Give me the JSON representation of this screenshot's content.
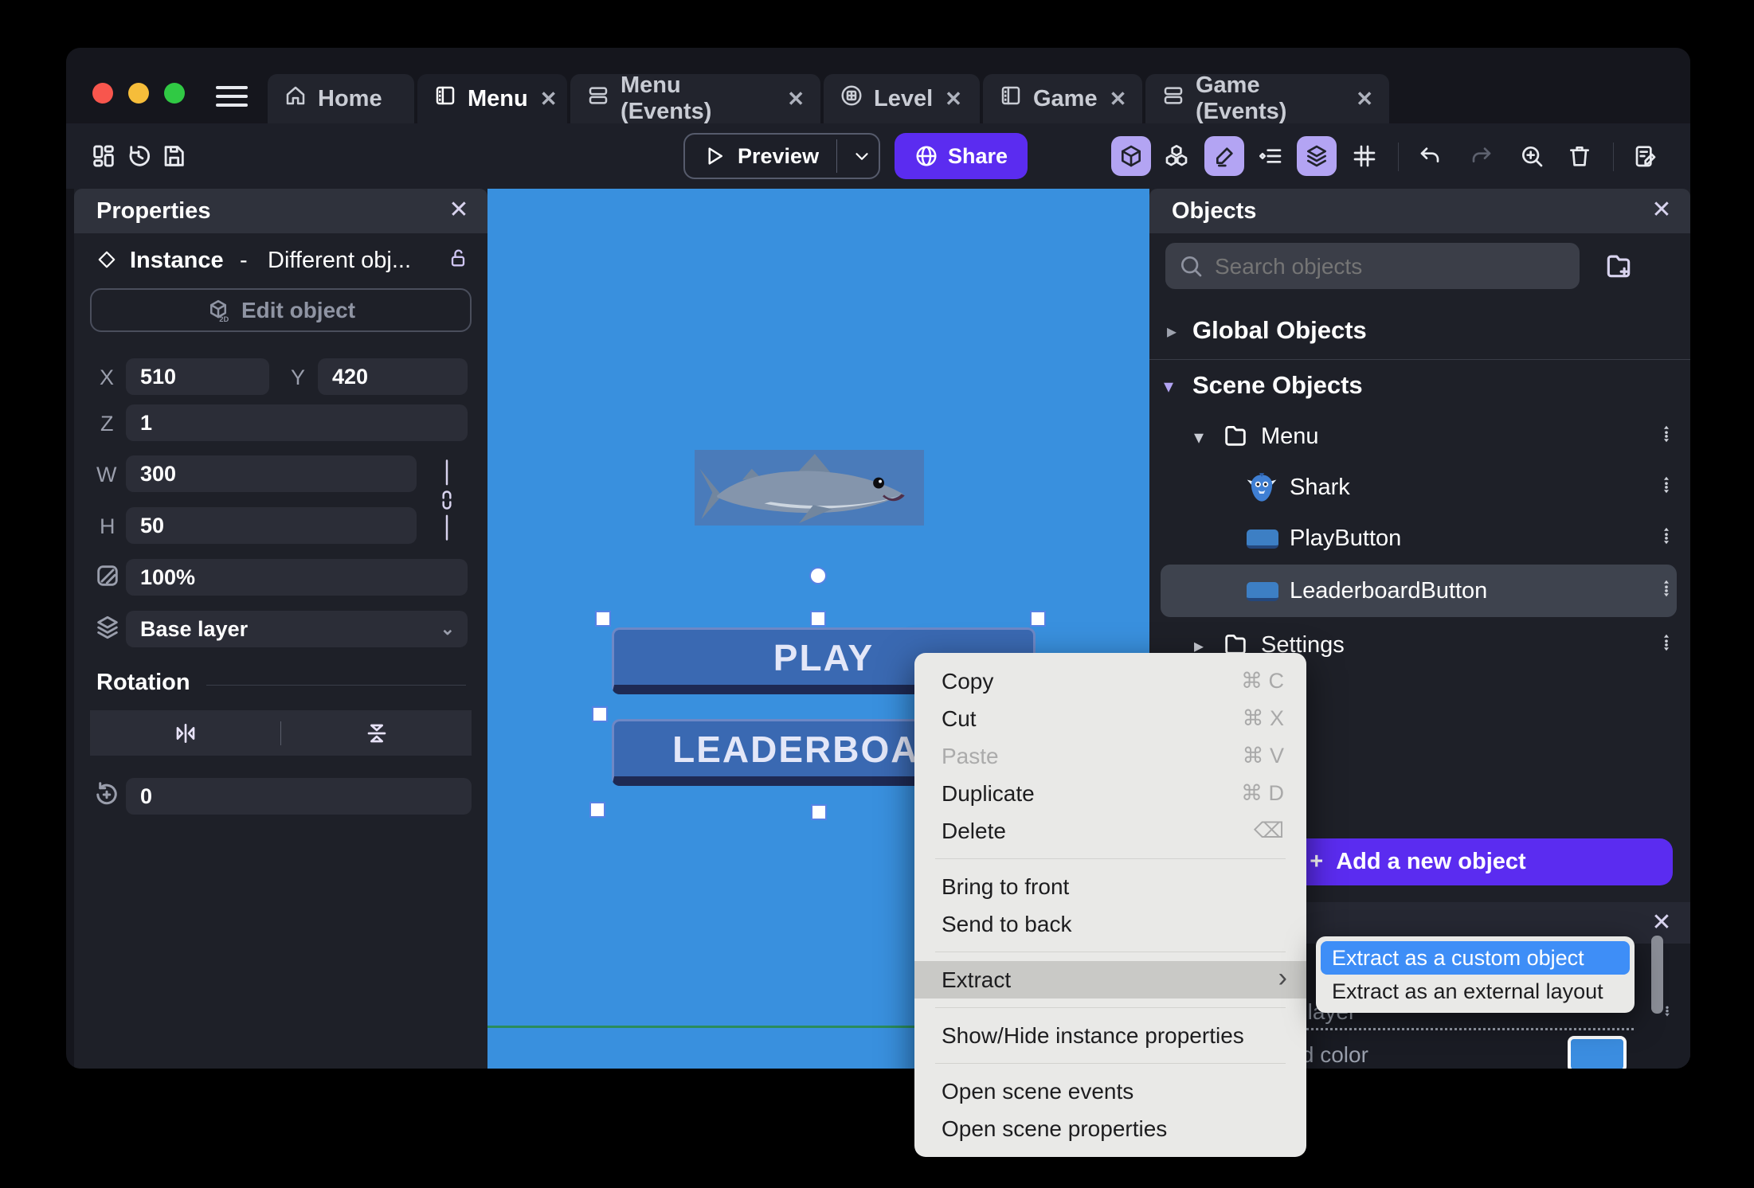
{
  "colors": {
    "accent_purple": "#5b2cf0",
    "active_tool_bg": "#b3a4f3",
    "canvas_blue": "#3990de",
    "game_button_blue": "#3a69b2",
    "selection_highlight_blue": "#3e8ef7",
    "background_color_swatch": "#3b8de0",
    "panel_bg": "#1e2028"
  },
  "titlebar": {
    "tabs": [
      {
        "label": "Home",
        "icon": "home-icon"
      },
      {
        "label": "Menu",
        "icon": "scene-icon",
        "close": "✕",
        "active": true
      },
      {
        "label": "Menu (Events)",
        "icon": "events-icon",
        "close": "✕"
      },
      {
        "label": "Level",
        "icon": "level-icon",
        "close": "✕"
      },
      {
        "label": "Game",
        "icon": "scene-icon",
        "close": "✕"
      },
      {
        "label": "Game (Events)",
        "icon": "events-icon",
        "close": "✕"
      }
    ]
  },
  "toolbar": {
    "preview_label": "Preview",
    "share_label": "Share",
    "left_icons": [
      "layout-icon",
      "history-icon",
      "save-icon"
    ],
    "right_icons": [
      "cube-3d-icon",
      "objects-cubes-icon",
      "edit-pencil-icon",
      "instance-list-icon",
      "layers-icon",
      "grid-icon",
      "undo-icon",
      "redo-icon",
      "zoom-in-icon",
      "trash-icon",
      "notes-icon"
    ]
  },
  "properties_panel": {
    "title": "Properties",
    "close": "✕",
    "instance_label": "Instance",
    "instance_separator": "-",
    "instance_object": "Different obj...",
    "edit_object_label": "Edit object",
    "fields": {
      "x_label": "X",
      "x_value": "510",
      "y_label": "Y",
      "y_value": "420",
      "z_label": "Z",
      "z_value": "1",
      "w_label": "W",
      "w_value": "300",
      "h_label": "H",
      "h_value": "50",
      "opacity_value": "100%",
      "layer_value": "Base layer"
    },
    "rotation_title": "Rotation",
    "rotation_value": "0"
  },
  "canvas": {
    "play_button_label": "PLAY",
    "leaderboard_button_label": "LEADERBOARD"
  },
  "objects_panel": {
    "title": "Objects",
    "close": "✕",
    "search_placeholder": "Search objects",
    "global_objects_label": "Global Objects",
    "scene_objects_label": "Scene Objects",
    "tree": {
      "menu_folder": "Menu",
      "shark": "Shark",
      "play_button": "PlayButton",
      "leaderboard_button": "LeaderboardButton",
      "settings_folder": "Settings"
    },
    "add_button_plus": "+",
    "add_button_label": "Add a new object",
    "footer": {
      "close": "✕",
      "layer_row_label": "Base layer",
      "color_row_label": "Background color"
    }
  },
  "context_menu": {
    "items": [
      {
        "label": "Copy",
        "shortcut": "⌘ C"
      },
      {
        "label": "Cut",
        "shortcut": "⌘ X"
      },
      {
        "label": "Paste",
        "shortcut": "⌘ V",
        "disabled": true
      },
      {
        "label": "Duplicate",
        "shortcut": "⌘ D"
      },
      {
        "label": "Delete",
        "shortcut": "⌫"
      },
      {
        "label": "Bring to front"
      },
      {
        "label": "Send to back"
      },
      {
        "label": "Extract",
        "chevron": "›",
        "highlighted": true
      },
      {
        "label": "Show/Hide instance properties"
      },
      {
        "label": "Open scene events"
      },
      {
        "label": "Open scene properties"
      }
    ]
  },
  "submenu": {
    "items": [
      {
        "label": "Extract as a custom object",
        "selected": true
      },
      {
        "label": "Extract as an external layout"
      }
    ]
  }
}
